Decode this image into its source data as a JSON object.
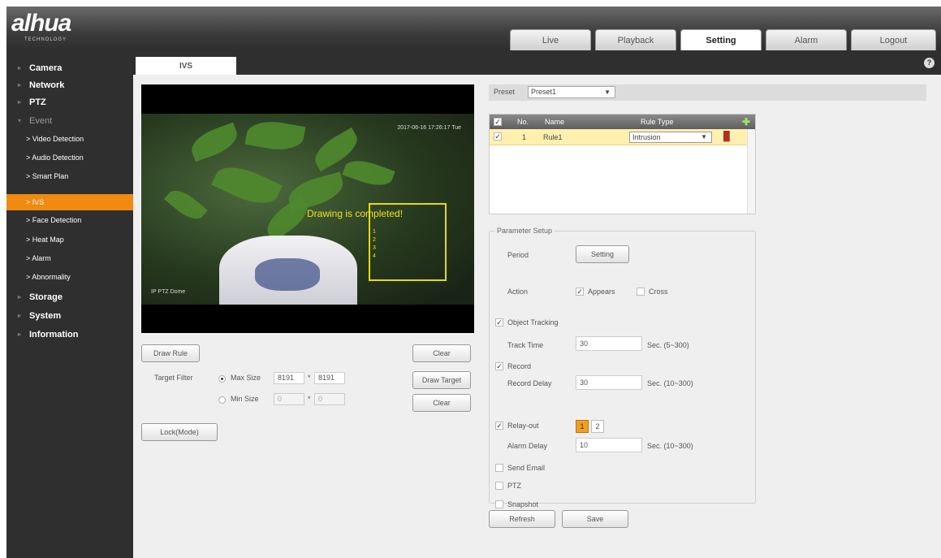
{
  "header": {
    "logo": "alhua",
    "logo_sub": "TECHNOLOGY",
    "nav": [
      "Live",
      "Playback",
      "Setting",
      "Alarm",
      "Logout"
    ],
    "active_nav": "Setting"
  },
  "sidebar": {
    "items": [
      {
        "label": "Camera",
        "level": 0
      },
      {
        "label": "Network",
        "level": 0
      },
      {
        "label": "PTZ",
        "level": 0
      },
      {
        "label": "Event",
        "level": 0,
        "expanded": true
      },
      {
        "label": "> Video Detection",
        "level": 1
      },
      {
        "label": "> Audio Detection",
        "level": 1
      },
      {
        "label": "> Smart Plan",
        "level": 1
      },
      {
        "label": "> IVS",
        "level": 1,
        "active": true
      },
      {
        "label": "> Face Detection",
        "level": 1
      },
      {
        "label": "> Heat Map",
        "level": 1
      },
      {
        "label": "> Alarm",
        "level": 1
      },
      {
        "label": "> Abnormality",
        "level": 1
      },
      {
        "label": "Storage",
        "level": 0
      },
      {
        "label": "System",
        "level": 0
      },
      {
        "label": "Information",
        "level": 0
      }
    ]
  },
  "tab": {
    "label": "IVS",
    "help": "?"
  },
  "video": {
    "osd_time": "2017-06-16 17:26:17 Tue",
    "osd_name": "IP PTZ Dome",
    "overlay_text": "Drawing is completed!",
    "rule_points": [
      "1",
      "2",
      "3",
      "4"
    ]
  },
  "left_controls": {
    "draw_rule": "Draw Rule",
    "clear1": "Clear",
    "target_filter_label": "Target Filter",
    "max_size_label": "Max Size",
    "max_w": "8191",
    "max_h": "8191",
    "min_size_label": "Min Size",
    "min_w": "0",
    "min_h": "0",
    "times": "*",
    "draw_target": "Draw Target",
    "clear2": "Clear",
    "lock_mode": "Lock(Mode)"
  },
  "preset": {
    "label": "Preset",
    "value": "Preset1"
  },
  "rule_table": {
    "headers": {
      "no": "No.",
      "name": "Name",
      "rule_type": "Rule Type"
    },
    "rows": [
      {
        "checked": true,
        "no": "1",
        "name": "Rule1",
        "rule_type": "Intrusion"
      }
    ]
  },
  "params": {
    "legend": "Parameter Setup",
    "period_label": "Period",
    "period_button": "Setting",
    "action_label": "Action",
    "appears_label": "Appears",
    "appears_checked": true,
    "cross_label": "Cross",
    "cross_checked": false,
    "object_tracking_label": "Object Tracking",
    "object_tracking_checked": true,
    "track_time_label": "Track Time",
    "track_time_value": "30",
    "track_time_range": "Sec. (5~300)",
    "record_label": "Record",
    "record_checked": true,
    "record_delay_label": "Record Delay",
    "record_delay_value": "30",
    "record_delay_range": "Sec. (10~300)",
    "relay_out_label": "Relay-out",
    "relay_out_checked": true,
    "relay_channels": [
      "1",
      "2"
    ],
    "alarm_delay_label": "Alarm Delay",
    "alarm_delay_value": "10",
    "alarm_delay_range": "Sec. (10~300)",
    "send_email_label": "Send Email",
    "ptz_label": "PTZ",
    "snapshot_label": "Snapshot"
  },
  "footer": {
    "refresh": "Refresh",
    "save": "Save"
  }
}
